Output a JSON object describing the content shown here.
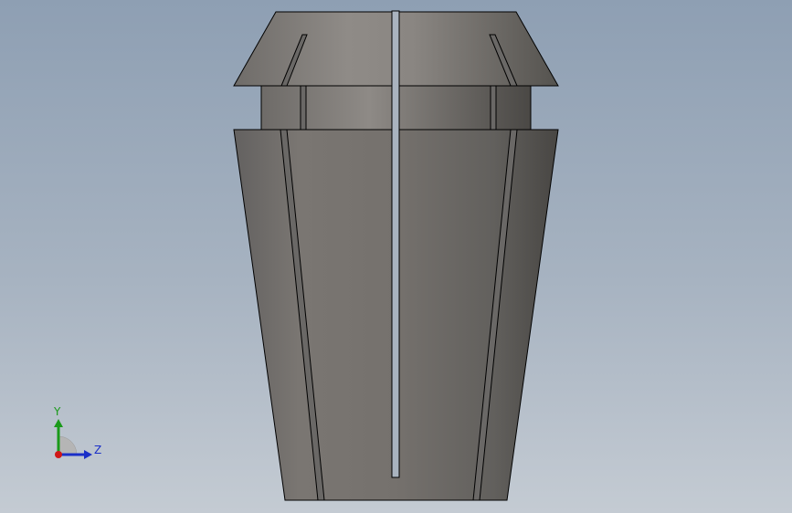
{
  "viewport": {
    "background_top": "#8e9fb3",
    "background_bottom": "#c4cbd3"
  },
  "model": {
    "name": "collet",
    "body_color": "#7a7672",
    "outline_color": "#000000"
  },
  "triad": {
    "y_label": "Y",
    "z_label": "Z",
    "y_color": "#1a9a1a",
    "z_color": "#1a2fc8",
    "x_color": "#d01818"
  }
}
